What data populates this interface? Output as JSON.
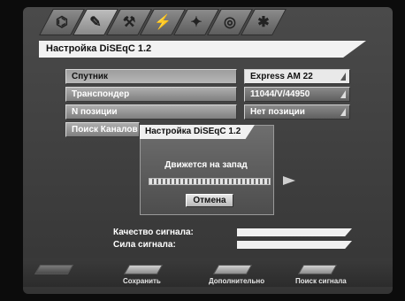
{
  "tabs": [
    {
      "icon": "satellite-dish-icon",
      "glyph": "⌬",
      "active": false
    },
    {
      "icon": "wrench-icon",
      "glyph": "✎",
      "active": true
    },
    {
      "icon": "tool-icon",
      "glyph": "⚒",
      "active": false
    },
    {
      "icon": "antenna-icon",
      "glyph": "⚡",
      "active": false
    },
    {
      "icon": "signal-icon",
      "glyph": "✦",
      "active": false
    },
    {
      "icon": "disk-icon",
      "glyph": "◎",
      "active": false
    },
    {
      "icon": "settings-icon",
      "glyph": "✱",
      "active": false
    }
  ],
  "title": "Настройка DiSEqC 1.2",
  "rows": [
    {
      "label": "Спутник",
      "value": "Express AM 22",
      "selected": true
    },
    {
      "label": "Транспондер",
      "value": "11044/V/44950",
      "selected": false
    },
    {
      "label": "N позиции",
      "value": "Нет позиции",
      "selected": false
    },
    {
      "label": "Поиск Каналов",
      "value": "",
      "selected": false
    }
  ],
  "popup": {
    "title": "Настройка DiSEqC 1.2",
    "message": "Движется на запад",
    "progress_percent": 100,
    "cancel_label": "Отмена"
  },
  "signal": {
    "quality_label": "Качество сигнала:",
    "strength_label": "Сила сигнала:"
  },
  "bottom": [
    {
      "label": ""
    },
    {
      "label": "Сохранить"
    },
    {
      "label": "Дополнительно"
    },
    {
      "label": "Поиск сигнала"
    }
  ]
}
